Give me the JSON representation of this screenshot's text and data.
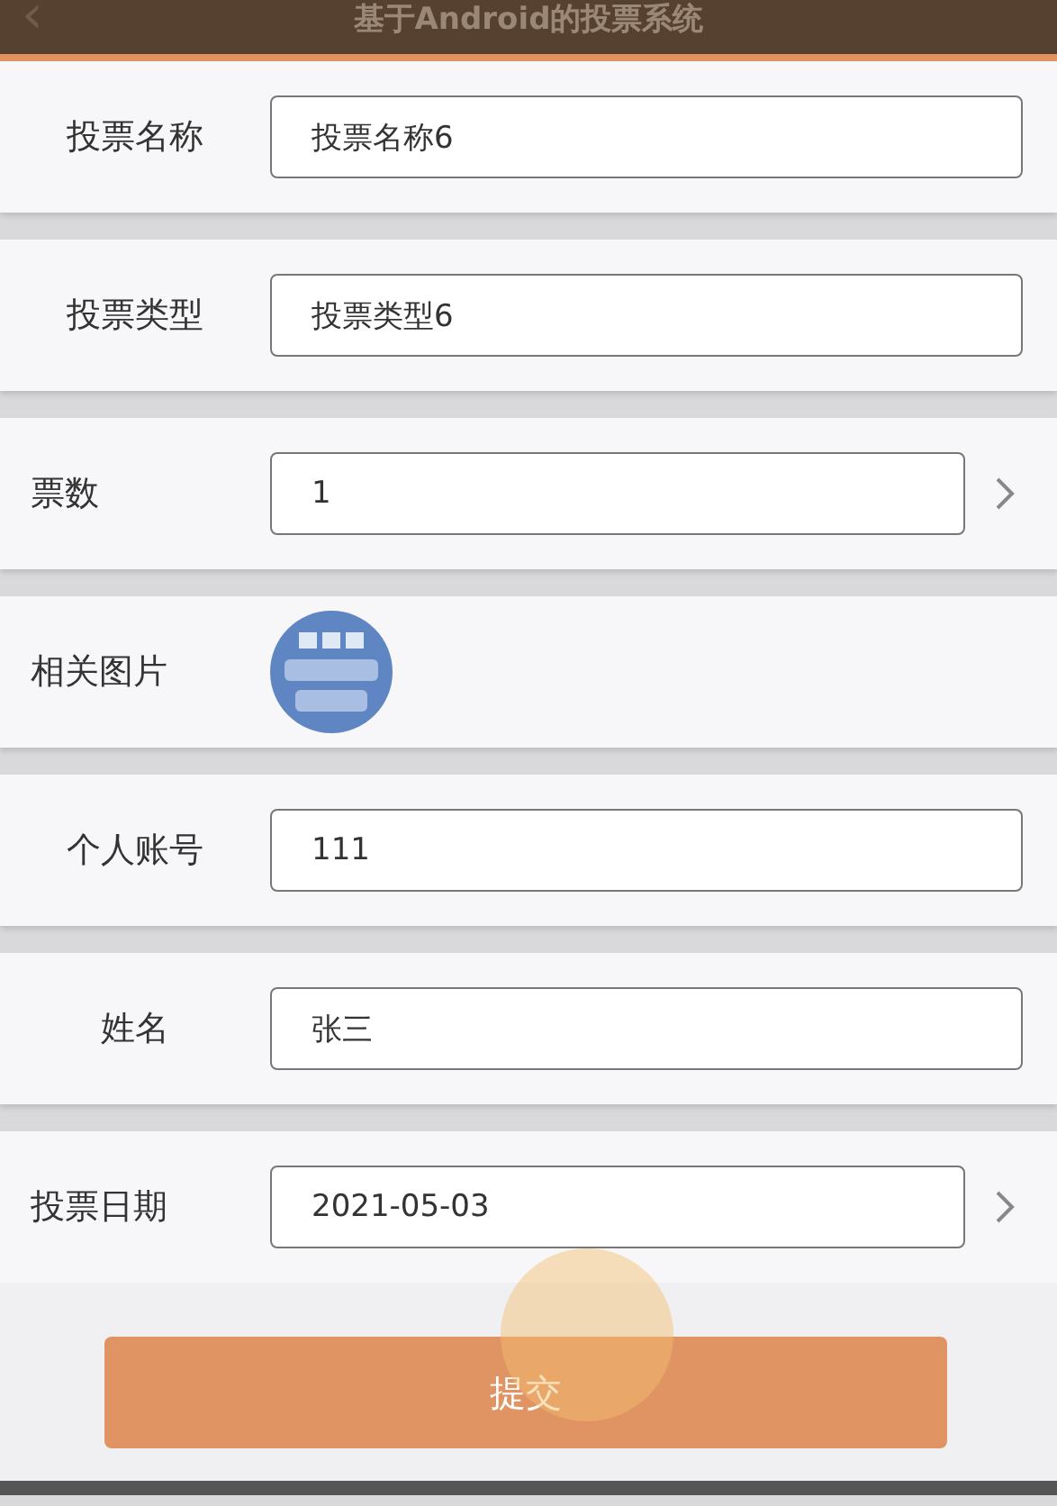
{
  "header": {
    "back_icon": "‹",
    "title": "基于Android的投票系统"
  },
  "rows": [
    {
      "kind": "text",
      "label": "投票名称",
      "value": "投票名称6"
    },
    {
      "kind": "text",
      "label": "投票类型",
      "value": "投票类型6"
    },
    {
      "kind": "select",
      "label": "票数",
      "value": "1"
    },
    {
      "label": "相关图片"
    },
    {
      "kind": "text",
      "label": "个人账号",
      "value": "111"
    },
    {
      "kind": "text",
      "label": "姓名",
      "value": "张三"
    },
    {
      "kind": "select",
      "label": "投票日期",
      "value": "2021-05-03"
    }
  ],
  "submit": "提交"
}
